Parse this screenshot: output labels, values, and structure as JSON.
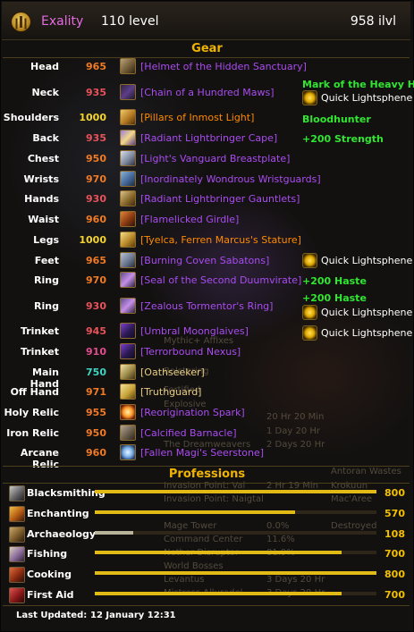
{
  "header": {
    "name": "Exality",
    "level": "110 level",
    "item_level": "958 ilvl",
    "name_color": "#e56be2"
  },
  "gear_title": "Gear",
  "gear": [
    {
      "slot": "Head",
      "ilvl": "965",
      "ilvl_color": "#f17a24",
      "name": "[Helmet of the Hidden Sanctuary]",
      "quality": "epic",
      "icon": "helmet-icon"
    },
    {
      "slot": "Neck",
      "ilvl": "935",
      "ilvl_color": "#e8525a",
      "name": "[Chain of a Hundred Maws]",
      "quality": "epic",
      "icon": "necklace-icon",
      "enchant": "Mark of the Heavy Hide",
      "gem": "Quick Lightsphene"
    },
    {
      "slot": "Shoulders",
      "ilvl": "1000",
      "ilvl_color": "#f5d430",
      "name": "[Pillars of Inmost Light]",
      "quality": "legendary",
      "icon": "shoulders-icon",
      "enchant": "Bloodhunter"
    },
    {
      "slot": "Back",
      "ilvl": "935",
      "ilvl_color": "#e8525a",
      "name": "[Radiant Lightbringer Cape]",
      "quality": "epic",
      "icon": "cape-icon",
      "enchant": "+200 Strength"
    },
    {
      "slot": "Chest",
      "ilvl": "950",
      "ilvl_color": "#f17a24",
      "name": "[Light's Vanguard Breastplate]",
      "quality": "epic",
      "icon": "chestplate-icon"
    },
    {
      "slot": "Wrists",
      "ilvl": "970",
      "ilvl_color": "#f17a24",
      "name": "[Inordinately Wondrous Wristguards]",
      "quality": "epic",
      "icon": "bracers-icon"
    },
    {
      "slot": "Hands",
      "ilvl": "930",
      "ilvl_color": "#e8525a",
      "name": "[Radiant Lightbringer Gauntlets]",
      "quality": "epic",
      "icon": "gauntlets-icon"
    },
    {
      "slot": "Waist",
      "ilvl": "960",
      "ilvl_color": "#f17a24",
      "name": "[Flamelicked Girdle]",
      "quality": "epic",
      "icon": "belt-icon"
    },
    {
      "slot": "Legs",
      "ilvl": "1000",
      "ilvl_color": "#f5d430",
      "name": "[Tyelca, Ferren Marcus's Stature]",
      "quality": "legendary",
      "icon": "leggings-icon"
    },
    {
      "slot": "Feet",
      "ilvl": "965",
      "ilvl_color": "#f17a24",
      "name": "[Burning Coven Sabatons]",
      "quality": "epic",
      "icon": "boots-icon",
      "gem": "Quick Lightsphene"
    },
    {
      "slot": "Ring",
      "ilvl": "970",
      "ilvl_color": "#f17a24",
      "name": "[Seal of the Second Duumvirate]",
      "quality": "epic",
      "icon": "ring-icon",
      "enchant": "+200 Haste"
    },
    {
      "slot": "Ring",
      "ilvl": "930",
      "ilvl_color": "#e8525a",
      "name": "[Zealous Tormentor's Ring]",
      "quality": "epic",
      "icon": "ring-icon",
      "enchant": "+200 Haste",
      "gem": "Quick Lightsphene"
    },
    {
      "slot": "Trinket",
      "ilvl": "945",
      "ilvl_color": "#e8525a",
      "name": "[Umbral Moonglaives]",
      "quality": "epic",
      "icon": "trinket-icon",
      "gem": "Quick Lightsphene"
    },
    {
      "slot": "Trinket",
      "ilvl": "910",
      "ilvl_color": "#e24d90",
      "name": "[Terrorbound Nexus]",
      "quality": "epic",
      "icon": "trinket-icon"
    },
    {
      "slot": "Main Hand",
      "ilvl": "750",
      "ilvl_color": "#3fd5c4",
      "name": "[Oathseeker]",
      "quality": "artifact",
      "icon": "sword-icon"
    },
    {
      "slot": "Off Hand",
      "ilvl": "971",
      "ilvl_color": "#f17a24",
      "name": "[Truthguard]",
      "quality": "artifact",
      "icon": "shield-icon"
    },
    {
      "slot": "Holy Relic",
      "ilvl": "955",
      "ilvl_color": "#f17a24",
      "name": "[Reorigination Spark]",
      "quality": "epic",
      "icon": "holy-relic-icon"
    },
    {
      "slot": "Iron Relic",
      "ilvl": "950",
      "ilvl_color": "#f17a24",
      "name": "[Calcified Barnacle]",
      "quality": "epic",
      "icon": "iron-relic-icon"
    },
    {
      "slot": "Arcane Relic",
      "ilvl": "960",
      "ilvl_color": "#f17a24",
      "name": "[Fallen Magi's Seerstone]",
      "quality": "epic",
      "icon": "arcane-relic-icon"
    }
  ],
  "quality_colors": {
    "epic": "#a94cf0",
    "legendary": "#ff8a00",
    "artifact": "#e6cc80"
  },
  "professions_title": "Professions",
  "professions": [
    {
      "name": "Blacksmithing",
      "value": "800",
      "level": 800,
      "max": 800,
      "bar_color": "#e2ba15",
      "icon": "anvil-icon"
    },
    {
      "name": "Enchanting",
      "value": "570",
      "level": 570,
      "max": 800,
      "bar_color": "#e2ba15",
      "icon": "enchanting-icon"
    },
    {
      "name": "Archaeology",
      "value": "108",
      "level": 108,
      "max": 800,
      "bar_color": "#b8b49b",
      "icon": "archaeology-icon"
    },
    {
      "name": "Fishing",
      "value": "700",
      "level": 700,
      "max": 800,
      "bar_color": "#e2ba15",
      "icon": "fishing-icon"
    },
    {
      "name": "Cooking",
      "value": "800",
      "level": 800,
      "max": 800,
      "bar_color": "#e2ba15",
      "icon": "cooking-icon"
    },
    {
      "name": "First Aid",
      "value": "700",
      "level": 700,
      "max": 800,
      "bar_color": "#e2ba15",
      "icon": "first-aid-icon"
    }
  ],
  "footer": {
    "label": "Last Updated:",
    "date": "12 January 12:31"
  }
}
